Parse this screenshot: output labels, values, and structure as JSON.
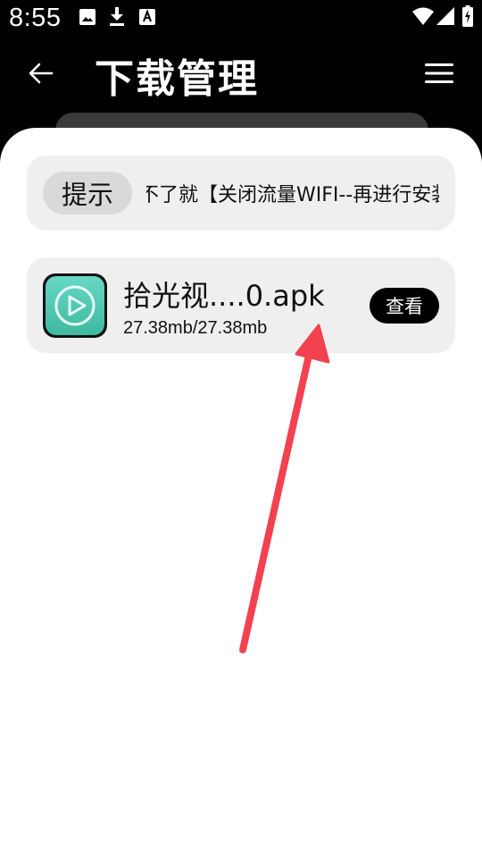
{
  "status_bar": {
    "time": "8:55",
    "left_icons": [
      "image-icon",
      "download-icon",
      "font-icon"
    ],
    "right_icons": [
      "wifi-icon",
      "signal-icon",
      "battery-charging-icon"
    ]
  },
  "app_bar": {
    "title": "下载管理",
    "back_icon": "back-arrow-icon",
    "menu_icon": "menu-icon"
  },
  "notice": {
    "chip_label": "提示",
    "text": "装不了就【关闭流量WIFI--再进行安装】"
  },
  "downloads": [
    {
      "name": "拾光视....0.apk",
      "progress": "27.38mb/27.38mb",
      "action_label": "查看",
      "icon": "play-icon"
    }
  ],
  "colors": {
    "header_bg": "#000000",
    "card_bg": "#efefef",
    "app_icon_teal": "#4fc9b0",
    "annotation_red": "#f2424f"
  }
}
